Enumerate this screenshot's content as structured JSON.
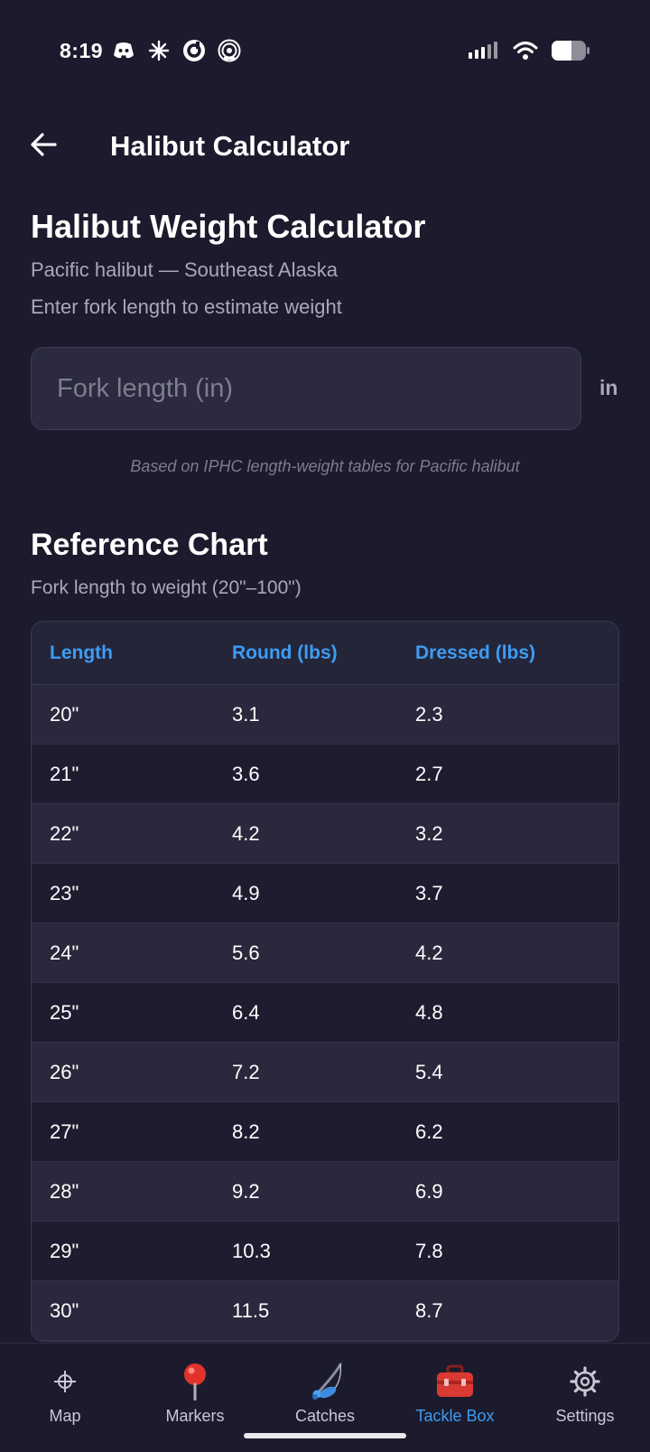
{
  "status_bar": {
    "time": "8:19",
    "left_icons": [
      "discord-icon",
      "sparkle-icon",
      "ring-app-icon",
      "podcast-icon"
    ],
    "right_icons": [
      "signal-icon",
      "wifi-icon",
      "battery-icon"
    ]
  },
  "header": {
    "title": "Halibut Calculator",
    "back_icon": "back-arrow-icon"
  },
  "calculator": {
    "title": "Halibut Weight Calculator",
    "subtitle": "Pacific halibut — Southeast Alaska",
    "instruction": "Enter fork length to estimate weight",
    "input_placeholder": "Fork length (in)",
    "input_value": "",
    "unit": "in",
    "note": "Based on IPHC length-weight tables for Pacific halibut"
  },
  "reference": {
    "title": "Reference Chart",
    "subtitle": "Fork length to weight (20\"–100\")",
    "columns": [
      "Length",
      "Round (lbs)",
      "Dressed (lbs)"
    ],
    "rows": [
      [
        "20\"",
        "3.1",
        "2.3"
      ],
      [
        "21\"",
        "3.6",
        "2.7"
      ],
      [
        "22\"",
        "4.2",
        "3.2"
      ],
      [
        "23\"",
        "4.9",
        "3.7"
      ],
      [
        "24\"",
        "5.6",
        "4.2"
      ],
      [
        "25\"",
        "6.4",
        "4.8"
      ],
      [
        "26\"",
        "7.2",
        "5.4"
      ],
      [
        "27\"",
        "8.2",
        "6.2"
      ],
      [
        "28\"",
        "9.2",
        "6.9"
      ],
      [
        "29\"",
        "10.3",
        "7.8"
      ],
      [
        "30\"",
        "11.5",
        "8.7"
      ]
    ]
  },
  "nav": {
    "items": [
      {
        "label": "Map",
        "icon": "crosshair-icon",
        "active": false
      },
      {
        "label": "Markers",
        "icon": "pin-icon",
        "active": false
      },
      {
        "label": "Catches",
        "icon": "fishing-rod-icon",
        "active": false
      },
      {
        "label": "Tackle Box",
        "icon": "toolbox-icon",
        "active": true
      },
      {
        "label": "Settings",
        "icon": "gear-icon",
        "active": false
      }
    ]
  },
  "colors": {
    "background": "#1c1b2d",
    "accent": "#3d9cf2",
    "input_bg": "#2b2a3e",
    "muted_text": "#a9a8b8"
  }
}
